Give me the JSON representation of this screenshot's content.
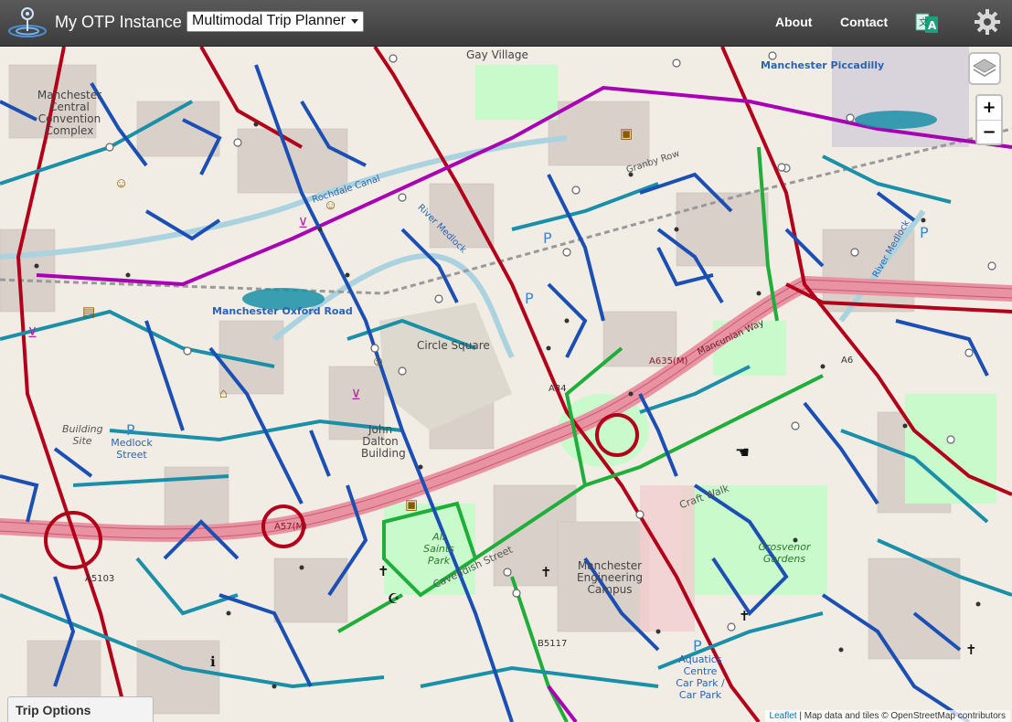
{
  "header": {
    "app_title": "My OTP Instance",
    "mode_select_value": "Multimodal Trip Planner",
    "nav_about": "About",
    "nav_contact": "Contact",
    "lang_icon": "language-translate-icon",
    "settings_icon": "gear-icon"
  },
  "map": {
    "labels": {
      "convention": "Manchester\nCentral\nConvention\nComplex",
      "gay_village": "Gay Village",
      "piccadilly": "Manchester Piccadilly",
      "oxford_road": "Manchester Oxford Road",
      "circle_square": "Circle Square",
      "john_dalton": "John\nDalton\nBuilding",
      "building_site": "Building\nSite",
      "medlock_street": "Medlock\nStreet",
      "all_saints_park": "All Saints\nPark",
      "cavendish_street": "Cavendish Street",
      "engineering": "Manchester\nEngineering\nCampus",
      "grosvenor_gardens": "Grosvenor\nGardens",
      "aquatics": "Aquatics\nCentre\nCar Park /\nCar Park",
      "craft_walk": "Craft Walk",
      "rochdale_canal": "Rochdale Canal",
      "river_medlock": "River Medlock",
      "river_medlock_e": "River Medlock",
      "a57m": "A57(M)",
      "a635": "A635(M)",
      "a5103": "A5103",
      "b5117": "B5117",
      "a34": "A34",
      "a665": "A6",
      "mancunian_way": "Mancunian Way",
      "granby_row": "Granby Row"
    },
    "colors": {
      "land": "#f1ede4",
      "building": "#d9d0c9",
      "park": "#c8facc",
      "route_blue": "#1c4fb3",
      "route_teal": "#1a8fa8",
      "route_green": "#1fae3a",
      "route_red": "#b3001a",
      "route_purple": "#a800b3",
      "motorway": "#e892a2"
    }
  },
  "controls": {
    "layers_icon": "layers-icon",
    "zoom_in": "+",
    "zoom_out": "−"
  },
  "trip_options": {
    "label": "Trip Options"
  },
  "attribution": {
    "leaflet": "Leaflet",
    "text": " | Map data and tiles © OpenStreetMap contributors"
  }
}
